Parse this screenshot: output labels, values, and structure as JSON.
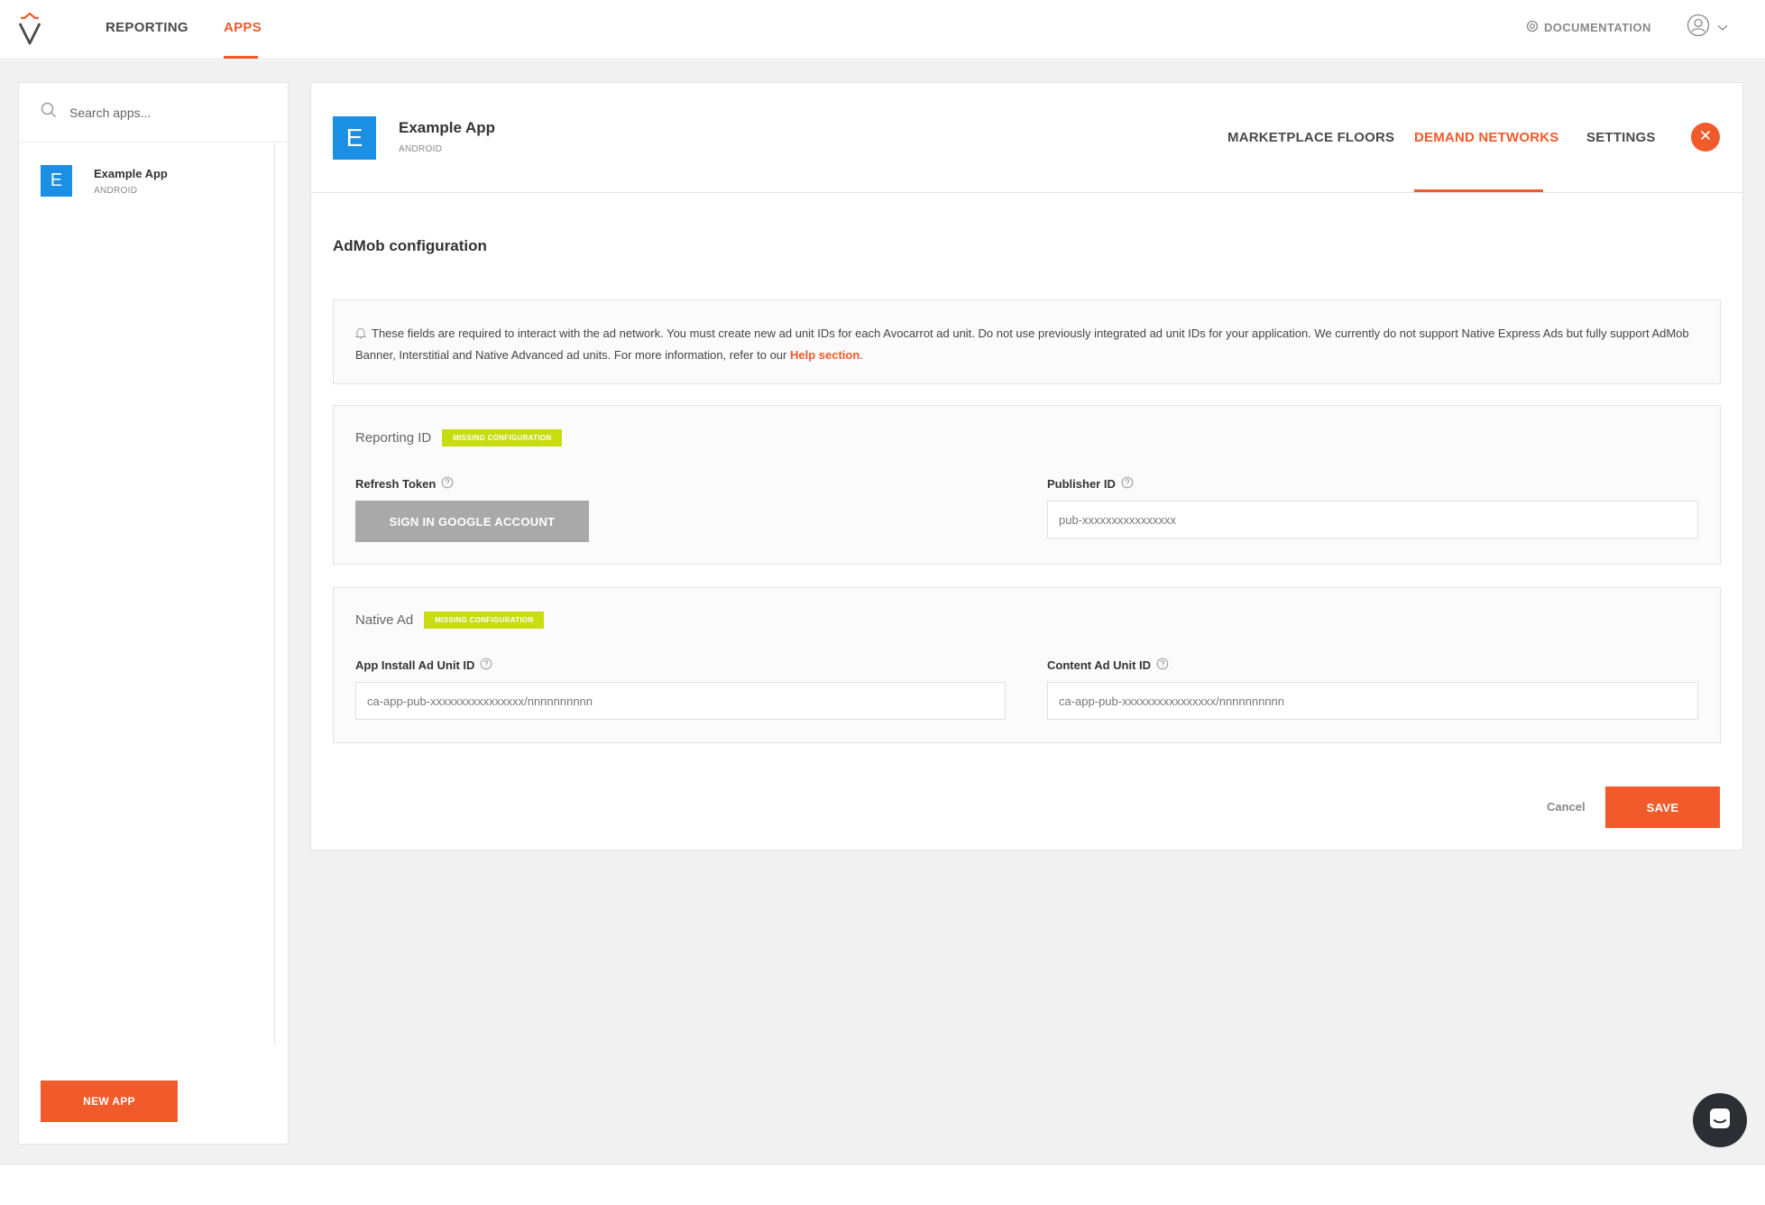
{
  "nav": {
    "reporting": "REPORTING",
    "apps": "APPS",
    "documentation": "DOCUMENTATION"
  },
  "sidebar": {
    "search_placeholder": "Search apps...",
    "apps": [
      {
        "initial": "E",
        "name": "Example App",
        "platform": "ANDROID"
      }
    ],
    "new_app_label": "NEW APP"
  },
  "app": {
    "initial": "E",
    "name": "Example App",
    "platform": "ANDROID"
  },
  "tabs": [
    {
      "label": "MARKETPLACE FLOORS",
      "active": false
    },
    {
      "label": "DEMAND NETWORKS",
      "active": true
    },
    {
      "label": "SETTINGS",
      "active": false
    }
  ],
  "section_title": "AdMob configuration",
  "info": {
    "text": "These fields are required to interact with the ad network. You must create new ad unit IDs for each Avocarrot ad unit. Do not use previously integrated ad unit IDs for your application. We currently do not support Native Express Ads but fully support AdMob Banner, Interstitial and Native Advanced ad units. For more information, refer to our ",
    "link": "Help section",
    "suffix": "."
  },
  "reporting": {
    "title": "Reporting ID",
    "badge": "MISSING CONFIGURATION",
    "refresh_token_label": "Refresh Token",
    "google_button": "SIGN IN GOOGLE ACCOUNT",
    "publisher_label": "Publisher ID",
    "publisher_placeholder": "pub-xxxxxxxxxxxxxxxx"
  },
  "native_ad": {
    "title": "Native Ad",
    "badge": "MISSING CONFIGURATION",
    "app_install_label": "App Install Ad Unit ID",
    "app_install_placeholder": "ca-app-pub-xxxxxxxxxxxxxxxx/nnnnnnnnnn",
    "content_label": "Content Ad Unit ID",
    "content_placeholder": "ca-app-pub-xxxxxxxxxxxxxxxx/nnnnnnnnnn"
  },
  "actions": {
    "cancel": "Cancel",
    "save": "SAVE"
  },
  "colors": {
    "accent": "#f15a2b",
    "avatar": "#1a8fe3",
    "badge": "#c7dc11",
    "disabled_button": "#a9a9a9"
  }
}
